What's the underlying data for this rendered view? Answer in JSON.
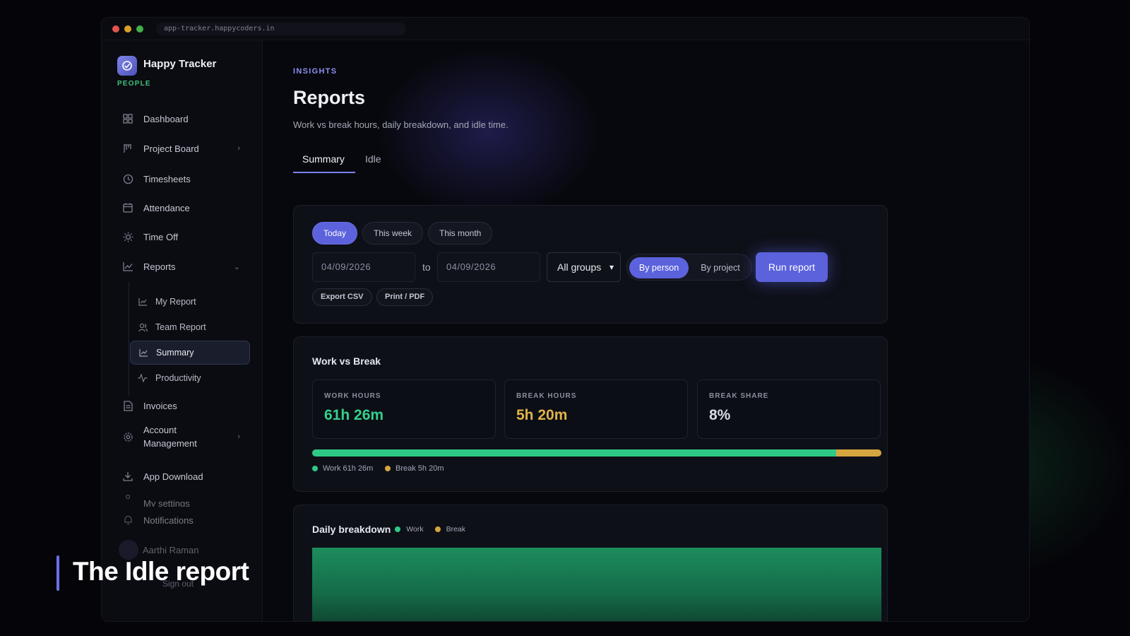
{
  "browser": {
    "url": "app-tracker.happycoders.in"
  },
  "brand": {
    "name": "Happy Tracker",
    "tag": "PEOPLE"
  },
  "nav": {
    "dashboard": "Dashboard",
    "project_board": "Project Board",
    "timesheets": "Timesheets",
    "attendance": "Attendance",
    "time_off": "Time Off",
    "reports": "Reports",
    "sub": {
      "my_report": "My Report",
      "team_report": "Team Report",
      "summary": "Summary",
      "productivity": "Productivity"
    },
    "invoices": "Invoices",
    "account_management": "Account Management",
    "app_download": "App Download",
    "my_settings": "My settings",
    "notifications": "Notifications",
    "user_name": "Aarthi Raman",
    "sign_out": "Sign out"
  },
  "page": {
    "eyebrow": "INSIGHTS",
    "title": "Reports",
    "subtitle": "Work vs break hours, daily breakdown, and idle time."
  },
  "tabs": {
    "summary": "Summary",
    "idle": "Idle"
  },
  "filters": {
    "today": "Today",
    "this_week": "This week",
    "this_month": "This month",
    "from_date": "04/09/2026",
    "to_label": "to",
    "to_date": "04/09/2026",
    "group_select": "All groups",
    "by_person": "By person",
    "by_project": "By project",
    "run_report": "Run report",
    "export_csv": "Export CSV",
    "print_pdf": "Print / PDF"
  },
  "work_vs_break": {
    "title": "Work vs Break",
    "work_label": "WORK HOURS",
    "work_value": "61h 26m",
    "break_label": "BREAK HOURS",
    "break_value": "5h 20m",
    "share_label": "BREAK SHARE",
    "share_value": "8%",
    "work_fraction": 0.92,
    "legend_work": "Work 61h 26m",
    "legend_break": "Break 5h 20m"
  },
  "daily": {
    "title": "Daily breakdown",
    "legend_work": "Work",
    "legend_break": "Break"
  },
  "colors": {
    "accent": "#5b62dc",
    "work": "#2ec986",
    "break": "#d4a640",
    "brand_tag": "#3fc27c"
  },
  "overlay": {
    "caption": "The Idle report"
  }
}
